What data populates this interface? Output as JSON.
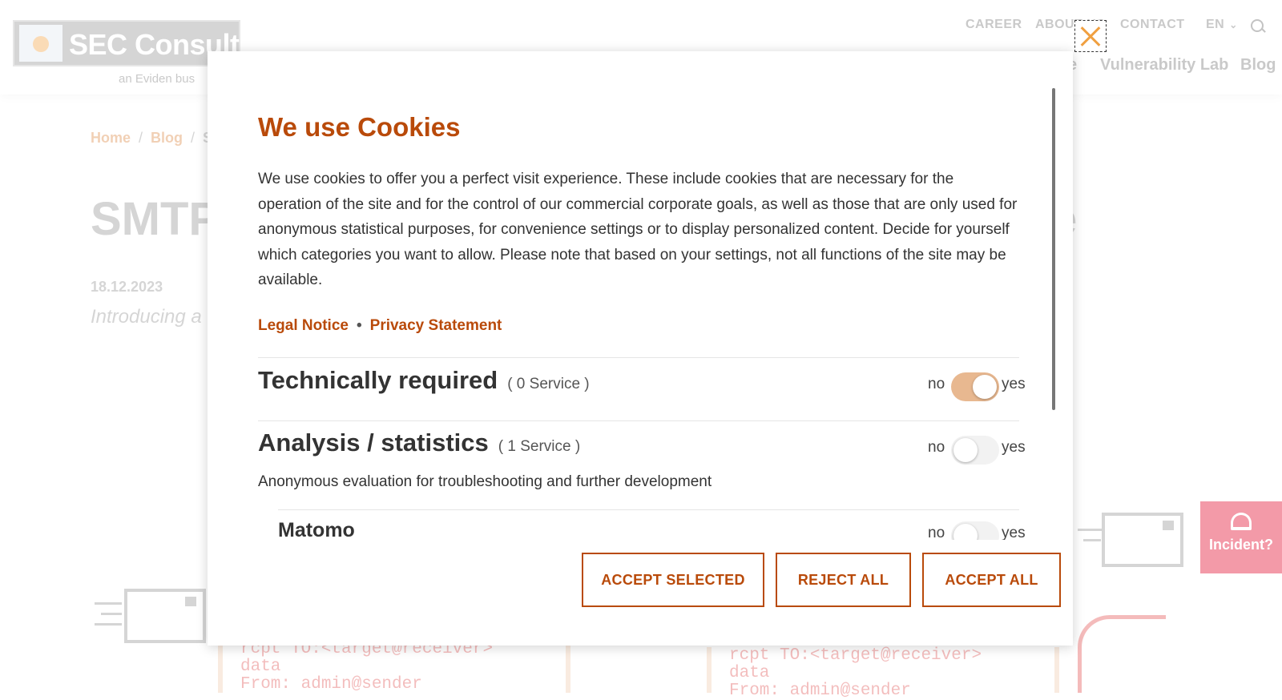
{
  "site": {
    "logo_text": "SEC Consult",
    "logo_subtitle": "an Eviden bus",
    "top_nav": [
      "CAREER",
      "ABOUT US",
      "CONTACT"
    ],
    "language": "EN",
    "main_nav_partial": "e",
    "main_nav": [
      "Vulnerability Lab",
      "Blog"
    ],
    "breadcrumb": [
      "Home",
      "Blog",
      "S"
    ],
    "article_title_partial": "SMTP",
    "article_title_end": "e",
    "article_date": "18.12.2023",
    "article_intro_partial": "Introducing a",
    "code_lines": [
      "rcpt TO:<target@receiver>",
      "data",
      "From: admin@sender"
    ],
    "incident_label": "Incident?"
  },
  "cookie_modal": {
    "title": "We use Cookies",
    "body": "We use cookies to offer you a perfect visit experience. These include cookies that are necessary for the operation of the site and for the control of our commercial corporate goals, as well as those that are only used for anonymous statistical purposes, for convenience settings or to display personalized content. Decide for yourself which categories you want to allow. Please note that based on your settings, not all functions of the site may be available.",
    "legal_notice": "Legal Notice",
    "link_separator": "•",
    "privacy_statement": "Privacy Statement",
    "toggle_no": "no",
    "toggle_yes": "yes",
    "categories": [
      {
        "title": "Technically required",
        "count": "( 0 Service )",
        "enabled": true
      },
      {
        "title": "Analysis / statistics",
        "count": "( 1 Service )",
        "description": "Anonymous evaluation for troubleshooting and further development",
        "enabled": false
      }
    ],
    "service": {
      "title": "Matomo",
      "enabled": false
    },
    "buttons": {
      "accept_selected": "ACCEPT SELECTED",
      "reject_all": "REJECT ALL",
      "accept_all": "ACCEPT ALL"
    },
    "colors": {
      "accent": "#b94a0a",
      "toggle_on": "#e8b890"
    }
  }
}
